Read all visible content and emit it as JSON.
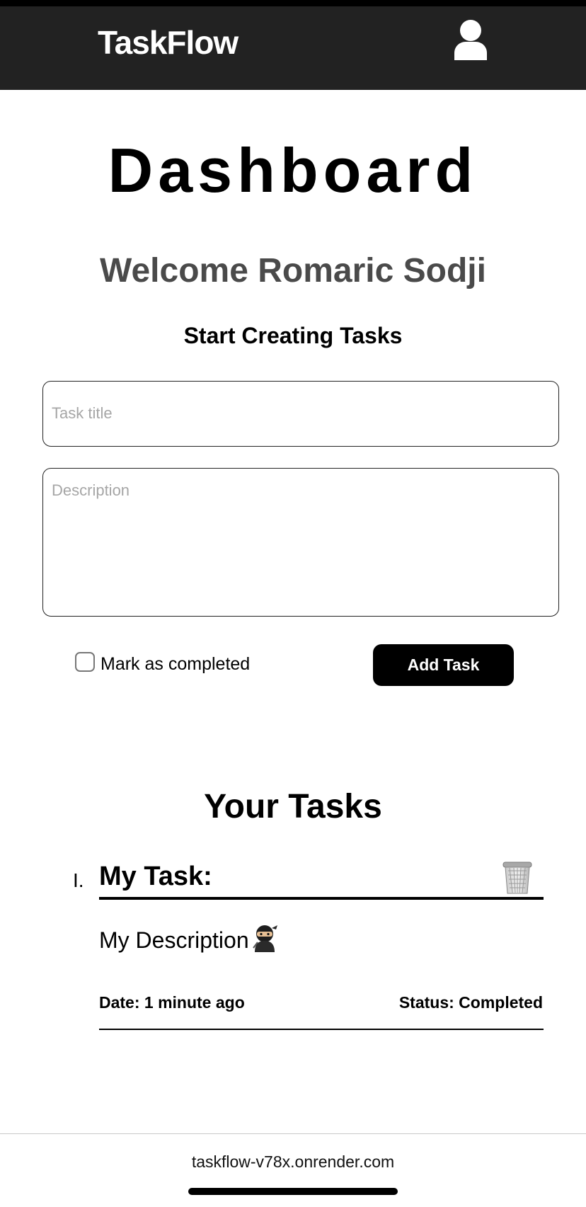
{
  "header": {
    "brand": "TaskFlow",
    "user_icon": "user-icon"
  },
  "main": {
    "title": "Dashboard",
    "welcome": "Welcome Romaric Sodji",
    "subtitle": "Start Creating Tasks"
  },
  "form": {
    "title_value": "",
    "title_placeholder": "Task title",
    "description_value": "",
    "description_placeholder": "Description",
    "completed_checked": false,
    "completed_label": "Mark as completed",
    "add_button_label": "Add Task"
  },
  "tasks": {
    "heading": "Your Tasks",
    "items": [
      {
        "index": "I.",
        "title": "My Task:",
        "description": "My Description",
        "description_icon": "ninja-emoji-icon",
        "date": "Date: 1 minute ago",
        "status": "Status: Completed",
        "delete_icon": "trash-icon"
      }
    ]
  },
  "browser": {
    "url": "taskflow-v78x.onrender.com"
  }
}
